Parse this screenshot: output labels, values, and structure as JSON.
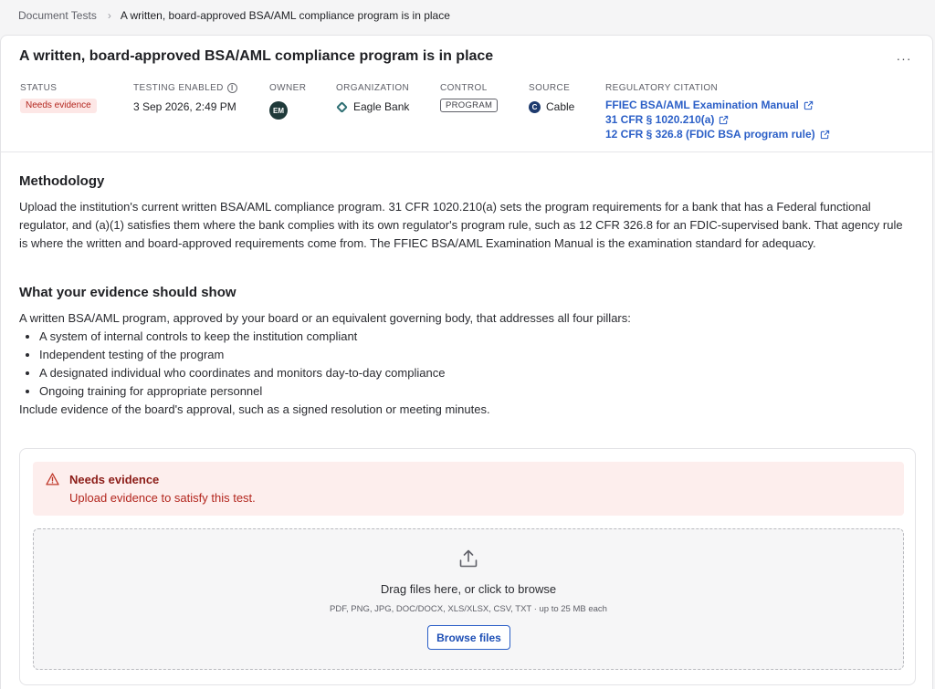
{
  "breadcrumb": {
    "parent": "Document Tests",
    "separator": "›",
    "current": "A written, board-approved BSA/AML compliance program is in place"
  },
  "header": {
    "title": "A written, board-approved BSA/AML compliance program is in place",
    "more_label": "···"
  },
  "meta": {
    "status": {
      "label": "STATUS",
      "value": "Needs evidence"
    },
    "testing": {
      "label": "TESTING ENABLED",
      "value": "3 Sep 2026, 2:49 PM",
      "info_icon": "i"
    },
    "owner": {
      "label": "OWNER",
      "initials": "EM"
    },
    "organization": {
      "label": "ORGANIZATION",
      "value": "Eagle Bank"
    },
    "control": {
      "label": "CONTROL",
      "value": "PROGRAM"
    },
    "source": {
      "label": "SOURCE",
      "icon_letter": "C",
      "value": "Cable"
    },
    "citation": {
      "label": "REGULATORY CITATION",
      "links": [
        "FFIEC BSA/AML Examination Manual",
        "31 CFR § 1020.210(a)",
        "12 CFR § 326.8 (FDIC BSA program rule)"
      ]
    }
  },
  "methodology": {
    "heading": "Methodology",
    "text": "Upload the institution's current written BSA/AML compliance program. 31 CFR 1020.210(a) sets the program requirements for a bank that has a Federal functional regulator, and (a)(1) satisfies them where the bank complies with its own regulator's program rule, such as 12 CFR 326.8 for an FDIC-supervised bank. That agency rule is where the written and board-approved requirements come from. The FFIEC BSA/AML Examination Manual is the examination standard for adequacy."
  },
  "evidence_guide": {
    "heading": "What your evidence should show",
    "intro": "A written BSA/AML program, approved by your board or an equivalent governing body, that addresses all four pillars:",
    "pillars": [
      "A system of internal controls to keep the institution compliant",
      "Independent testing of the program",
      "A designated individual who coordinates and monitors day-to-day compliance",
      "Ongoing training for appropriate personnel"
    ],
    "outro": "Include evidence of the board's approval, such as a signed resolution or meeting minutes."
  },
  "alert": {
    "title": "Needs evidence",
    "description": "Upload evidence to satisfy this test."
  },
  "dropzone": {
    "title": "Drag files here, or click to browse",
    "subtitle": "PDF, PNG, JPG, DOC/DOCX, XLS/XLSX, CSV, TXT · up to 25 MB each",
    "button_label": "Browse files"
  },
  "colors": {
    "link": "#2b5fc7",
    "status_bg": "#fde7e6",
    "status_text": "#b3261e",
    "alert_bg": "#fdeeed"
  },
  "icons": {
    "breadcrumb_separator": "chevron-right-icon",
    "more": "more-horizontal-icon",
    "info": "info-icon",
    "organization": "diamond-icon",
    "external_link": "external-link-icon",
    "alert": "warning-triangle-icon",
    "upload": "upload-icon"
  }
}
